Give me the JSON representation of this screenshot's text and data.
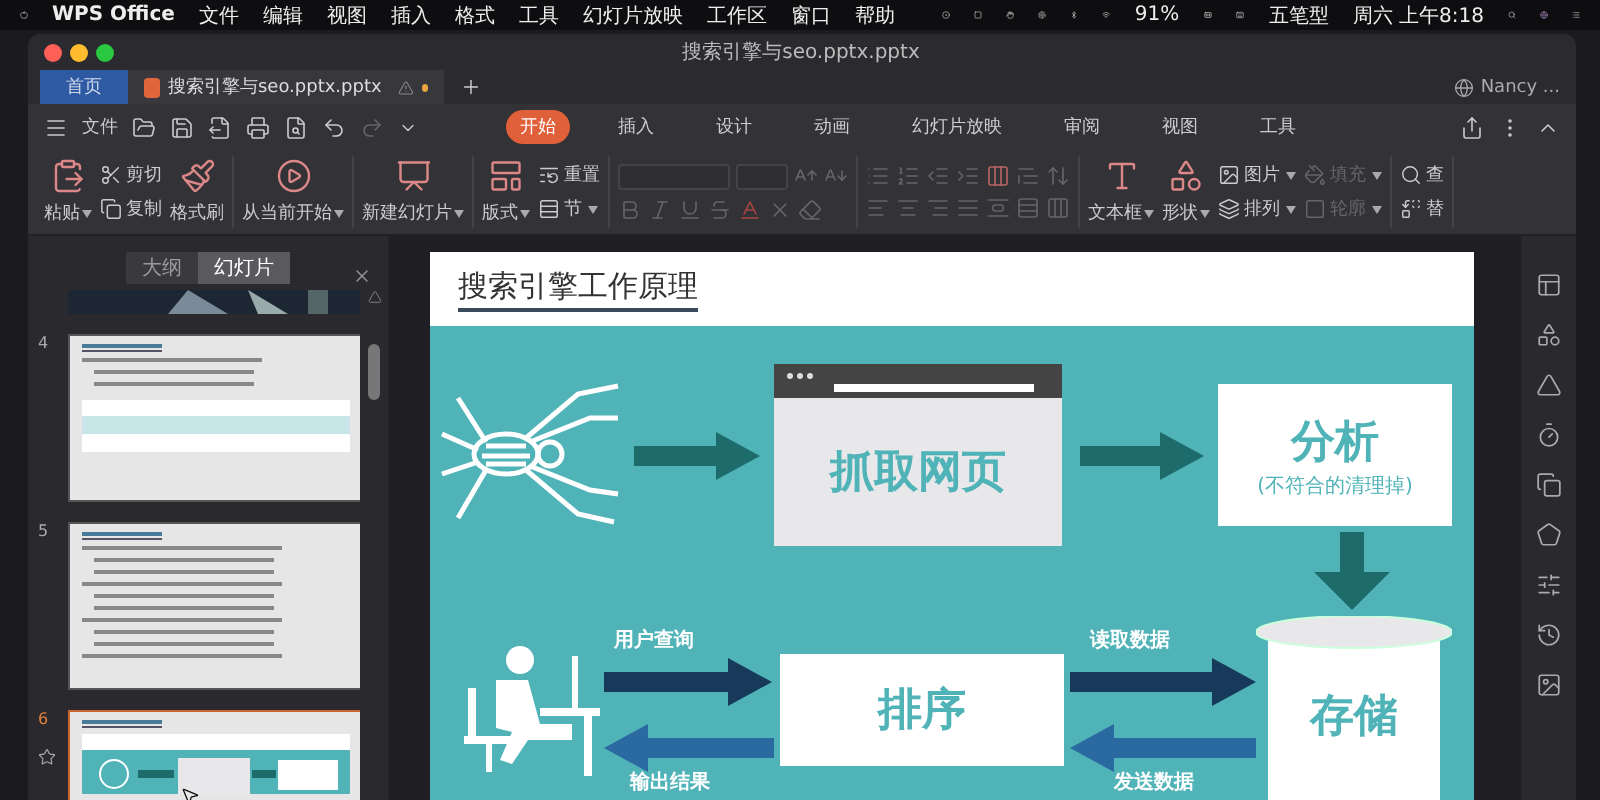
{
  "menubar": {
    "app": "WPS Office",
    "menus": [
      "文件",
      "编辑",
      "视图",
      "插入",
      "格式",
      "工具",
      "幻灯片放映",
      "工作区",
      "窗口",
      "帮助"
    ],
    "battery": "91%",
    "input_method": "五笔型",
    "clock": "周六 上午8:18"
  },
  "window": {
    "title": "搜索引擎与seo.pptx.pptx"
  },
  "tabs": [
    {
      "label": "首页",
      "selected": false,
      "kind": "home",
      "unsaved": false
    },
    {
      "label": "搜索引擎与seo.pptx.pptx",
      "selected": true,
      "kind": "document",
      "unsaved": true
    }
  ],
  "user": "Nancy ...",
  "file_menu": "文件",
  "ribbon_tabs": [
    {
      "label": "开始",
      "selected": true
    },
    {
      "label": "插入",
      "selected": false
    },
    {
      "label": "设计",
      "selected": false
    },
    {
      "label": "动画",
      "selected": false
    },
    {
      "label": "幻灯片放映",
      "selected": false
    },
    {
      "label": "审阅",
      "selected": false
    },
    {
      "label": "视图",
      "selected": false
    },
    {
      "label": "工具",
      "selected": false
    }
  ],
  "ribbon": [
    {
      "kind": "buttons",
      "items": [
        {
          "kind": "large",
          "label": "粘贴",
          "caret": true,
          "disabled": false
        },
        {
          "kind": "stack",
          "items": [
            {
              "label": "剪切",
              "caret": false,
              "disabled": false
            },
            {
              "label": "复制",
              "caret": false,
              "disabled": false
            }
          ]
        },
        {
          "kind": "large",
          "label": "格式刷",
          "caret": false,
          "disabled": false
        }
      ]
    },
    {
      "kind": "buttons",
      "items": [
        {
          "kind": "large",
          "label": "从当前开始",
          "caret": true,
          "disabled": false
        }
      ]
    },
    {
      "kind": "buttons",
      "items": [
        {
          "kind": "large",
          "label": "新建幻灯片",
          "caret": true,
          "disabled": false
        }
      ]
    },
    {
      "kind": "buttons",
      "items": [
        {
          "kind": "large",
          "label": "版式",
          "caret": true,
          "disabled": false
        },
        {
          "kind": "stack",
          "items": [
            {
              "label": "重置",
              "caret": false,
              "disabled": false
            },
            {
              "label": "节",
              "caret": true,
              "disabled": false
            }
          ]
        }
      ]
    },
    {
      "kind": "font"
    },
    {
      "kind": "paragraph"
    },
    {
      "kind": "buttons",
      "items": [
        {
          "kind": "large",
          "label": "文本框",
          "caret": true,
          "disabled": false
        },
        {
          "kind": "large",
          "label": "形状",
          "caret": true,
          "disabled": false
        },
        {
          "kind": "stack",
          "items": [
            {
              "label": "图片",
              "caret": true,
              "disabled": false
            },
            {
              "label": "排列",
              "caret": true,
              "disabled": false
            }
          ]
        },
        {
          "kind": "stack",
          "items": [
            {
              "label": "填充",
              "caret": true,
              "disabled": true
            },
            {
              "label": "轮廓",
              "caret": true,
              "disabled": true
            }
          ]
        }
      ]
    },
    {
      "kind": "buttons",
      "items": [
        {
          "kind": "stack",
          "items": [
            {
              "label": "查",
              "caret": false,
              "disabled": false
            },
            {
              "label": "替",
              "caret": false,
              "disabled": false
            }
          ]
        }
      ]
    }
  ],
  "panel_tabs": [
    {
      "label": "大纲",
      "selected": false
    },
    {
      "label": "幻灯片",
      "selected": true
    }
  ],
  "slides": [
    {
      "number": "4",
      "selected": false,
      "kind": "table"
    },
    {
      "number": "5",
      "selected": false,
      "kind": "bullets"
    },
    {
      "number": "6",
      "selected": true,
      "kind": "diagram"
    }
  ],
  "slide": {
    "title": "搜索引擎工作原理",
    "crawl": "抓取网页",
    "analyze": "分析",
    "analyze_note": "(不符合的清理掉)",
    "store": "存储",
    "rank": "排序",
    "query": "用户查询",
    "read": "读取数据",
    "output": "输出结果",
    "send": "发送数据"
  }
}
